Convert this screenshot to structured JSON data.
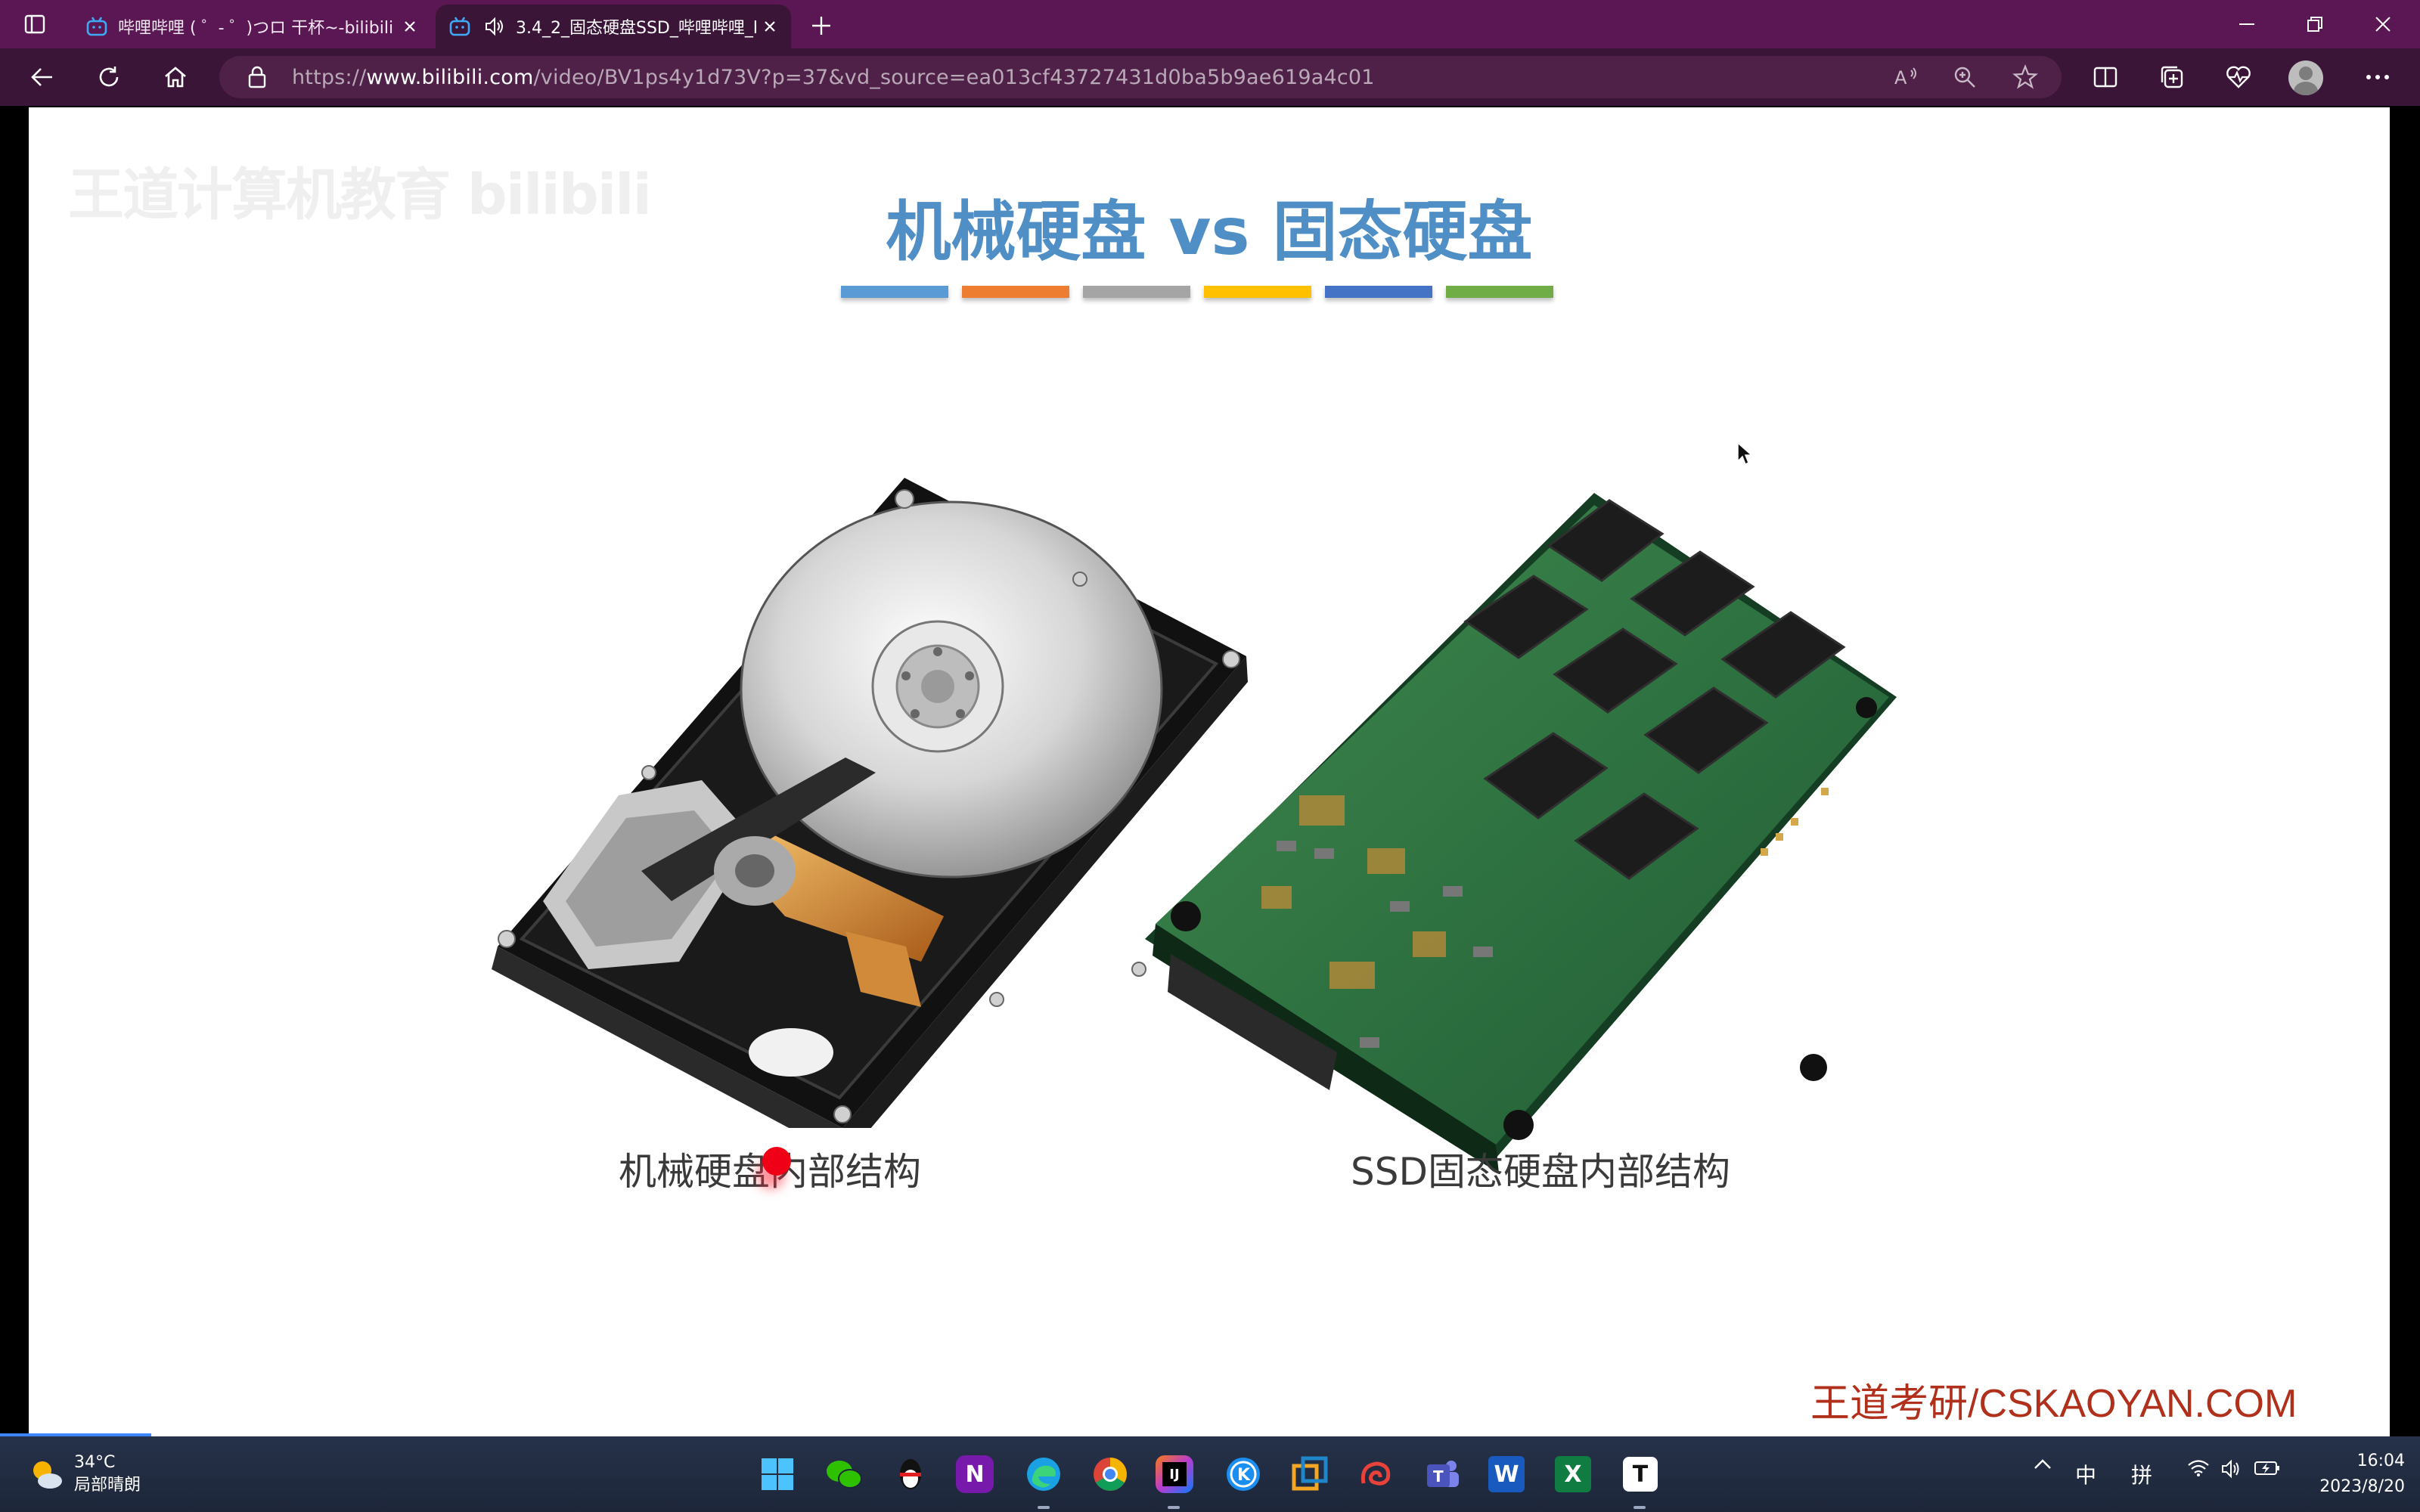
{
  "browser": {
    "tabs": [
      {
        "title": "哔哩哔哩 ( ゜- ゜)つロ 干杯~-bilibili"
      },
      {
        "title": "3.4_2_固态硬盘SSD_哔哩哔哩_bilibili"
      }
    ],
    "address": {
      "prefix": "https://",
      "domain": "www.bilibili.com",
      "path": "/video/BV1ps4y1d73V?p=37&vd_source=ea013cf43727431d0ba5b9ae619a4c01"
    },
    "colors": {
      "titlebar": "#5a1753",
      "toolbar": "#3b1537",
      "address_bg": "#4f2149"
    }
  },
  "slide": {
    "watermark": "王道计算机教育 bilibili",
    "title": "机械硬盘 vs 固态硬盘",
    "bar_colors": [
      "#5b9bd5",
      "#ed7d31",
      "#a5a5a5",
      "#ffc000",
      "#4472c4",
      "#70ad47"
    ],
    "hdd_caption": "机械硬盘内部结构",
    "ssd_caption": "SSD固态硬盘内部结构",
    "brand": "王道考研/CSKAOYAN.COM"
  },
  "taskbar": {
    "weather": {
      "temp": "34°C",
      "desc": "局部晴朗"
    },
    "apps": [
      "start",
      "wechat",
      "qq",
      "onenote",
      "edge",
      "chrome",
      "intellij",
      "kugou",
      "vmware",
      "snail",
      "teams",
      "word",
      "excel",
      "typora"
    ],
    "tray": {
      "ime_lang": "中",
      "ime_mode": "拼"
    },
    "clock": {
      "time": "16:04",
      "date": "2023/8/20"
    }
  }
}
